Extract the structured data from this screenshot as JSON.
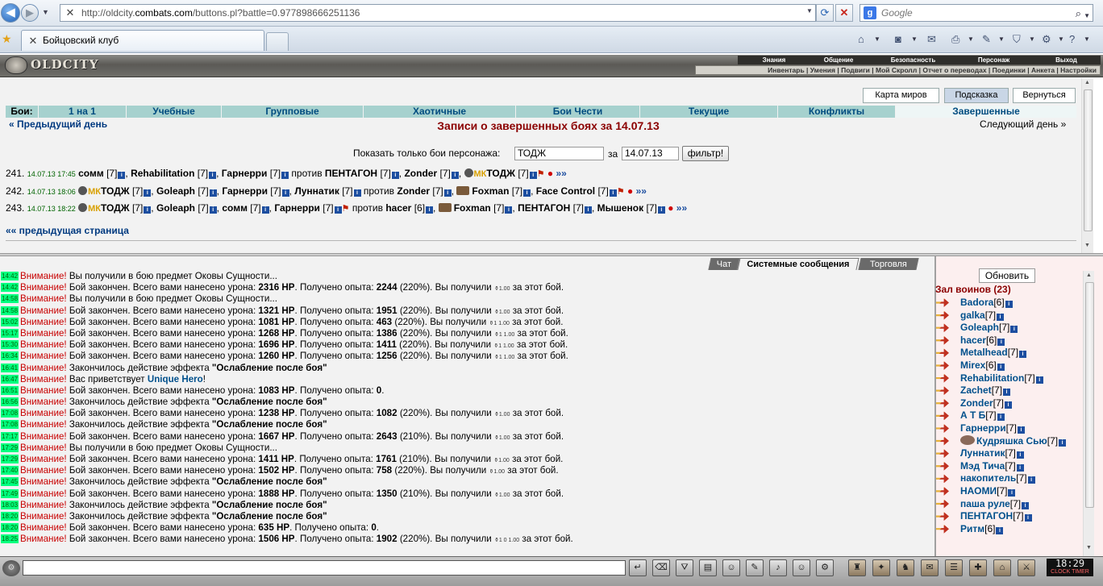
{
  "browser": {
    "url_prefix": "http://oldcity.",
    "url_domain": "combats.com",
    "url_path": "/buttons.pl?battle=0.977898666251136",
    "search_placeholder": "Google",
    "tab_title": "Бойцовский клуб"
  },
  "game": {
    "logo": "OLDCITY",
    "main_menu": [
      "Знания",
      "Общение",
      "Безопасность",
      "Персонаж",
      "Выход"
    ],
    "sub_menu": "Инвентарь | Умения | Подвиги | Мой Скролл | Отчет о переводах | Поединки | Анкета | Настройки"
  },
  "header_buttons": [
    "Карта миров",
    "Подсказка",
    "Вернуться"
  ],
  "fight_nav": [
    "Бои:",
    "1 на 1",
    "Учебные",
    "Групповые",
    "Хаотичные",
    "Бои Чести",
    "Текущие",
    "Конфликты",
    "Завершенные"
  ],
  "prev_day": "« Предыдущий день",
  "page_title": "Записи о завершенных боях за 14.07.13",
  "next_day": "Следующий день »",
  "filter": {
    "label": "Показать только бои персонажа:",
    "name": "ТОДЖ",
    "date_label": "за",
    "date": "14.07.13",
    "button": "фильтр!"
  },
  "battles": [
    {
      "num": "241.",
      "time": "14.07.13 17:45",
      "left": [
        {
          "n": "сомм",
          "l": "[7]"
        },
        {
          "n": "Rehabilitation",
          "l": "[7]"
        },
        {
          "n": "Гарнерри",
          "l": "[7]"
        }
      ],
      "vs": "против",
      "right": [
        {
          "n": "ПЕНТАГОН",
          "l": "[7]"
        },
        {
          "n": "Zonder",
          "l": "[7]"
        },
        {
          "n": "ТОДЖ",
          "l": "[7]",
          "clan": "МК"
        }
      ]
    },
    {
      "num": "242.",
      "time": "14.07.13 18:06",
      "left": [
        {
          "n": "ТОДЖ",
          "l": "[7]",
          "clan": "МК"
        },
        {
          "n": "Goleaph",
          "l": "[7]"
        },
        {
          "n": "Гарнерри",
          "l": "[7]"
        },
        {
          "n": "Луннатик",
          "l": "[7]"
        }
      ],
      "vs": "против",
      "right": [
        {
          "n": "Zonder",
          "l": "[7]"
        },
        {
          "n": "Foxman",
          "l": "[7]",
          "img": true
        },
        {
          "n": "Face Control",
          "l": "[7]"
        }
      ]
    },
    {
      "num": "243.",
      "time": "14.07.13 18:22",
      "left": [
        {
          "n": "ТОДЖ",
          "l": "[7]",
          "clan": "МК"
        },
        {
          "n": "Goleaph",
          "l": "[7]"
        },
        {
          "n": "сомм",
          "l": "[7]"
        },
        {
          "n": "Гарнерри",
          "l": "[7]"
        }
      ],
      "vs": "против",
      "right": [
        {
          "n": "hacer",
          "l": "[6]"
        },
        {
          "n": "Foxman",
          "l": "[7]",
          "img": true
        },
        {
          "n": "ПЕНТАГОН",
          "l": "[7]"
        },
        {
          "n": "Мышенок",
          "l": "[7]"
        }
      ]
    }
  ],
  "more": "»»",
  "prev_page": "«« предыдущая страница",
  "chat_tabs": [
    "Чат",
    "Системные сообщения",
    "Торговля"
  ],
  "messages": [
    {
      "t": "14:42",
      "type": "item",
      "text": "Вы получили в бою предмет Оковы Сущности..."
    },
    {
      "t": "14:42",
      "type": "fight",
      "dmg": "2316 HP",
      "exp": "2244",
      "pct": "(220%).",
      "coins": "1.00"
    },
    {
      "t": "14:58",
      "type": "item",
      "text": "Вы получили в бою предмет Оковы Сущности..."
    },
    {
      "t": "14:58",
      "type": "fight",
      "dmg": "1321 HP",
      "exp": "1951",
      "pct": "(220%).",
      "coins": "1.00"
    },
    {
      "t": "15:02",
      "type": "fight",
      "dmg": "1081 HP",
      "exp": "463",
      "pct": "(220%).",
      "coins": "1 1.00"
    },
    {
      "t": "15:17",
      "type": "fight",
      "dmg": "1268 HP",
      "exp": "1386",
      "pct": "(220%).",
      "coins": "1 1.00"
    },
    {
      "t": "15:30",
      "type": "fight",
      "dmg": "1696 HP",
      "exp": "1411",
      "pct": "(220%).",
      "coins": "1 1.00"
    },
    {
      "t": "16:34",
      "type": "fight",
      "dmg": "1260 HP",
      "exp": "1256",
      "pct": "(220%).",
      "coins": "1 1.00"
    },
    {
      "t": "16:41",
      "type": "effect"
    },
    {
      "t": "16:47",
      "type": "hero"
    },
    {
      "t": "16:51",
      "type": "fight0",
      "dmg": "1083 HP",
      "exp": "0"
    },
    {
      "t": "16:56",
      "type": "effect"
    },
    {
      "t": "17:08",
      "type": "fight",
      "dmg": "1238 HP",
      "exp": "1082",
      "pct": "(220%).",
      "coins": "1.00"
    },
    {
      "t": "17:08",
      "type": "effect"
    },
    {
      "t": "17:17",
      "type": "fight",
      "dmg": "1667 HP",
      "exp": "2643",
      "pct": "(210%).",
      "coins": "1.00"
    },
    {
      "t": "17:29",
      "type": "item",
      "text": "Вы получили в бою предмет Оковы Сущности..."
    },
    {
      "t": "17:29",
      "type": "fight",
      "dmg": "1411 HP",
      "exp": "1761",
      "pct": "(210%).",
      "coins": "1.00"
    },
    {
      "t": "17:40",
      "type": "fight",
      "dmg": "1502 HP",
      "exp": "758",
      "pct": "(220%).",
      "coins": "1.00"
    },
    {
      "t": "17:45",
      "type": "effect"
    },
    {
      "t": "17:49",
      "type": "fight",
      "dmg": "1888 HP",
      "exp": "1350",
      "pct": "(210%).",
      "coins": "1.00"
    },
    {
      "t": "18:03",
      "type": "effect"
    },
    {
      "t": "18:20",
      "type": "effect"
    },
    {
      "t": "18:20",
      "type": "fight0",
      "dmg": "635 HP",
      "exp": "0"
    },
    {
      "t": "18:25",
      "type": "fight",
      "dmg": "1506 HP",
      "exp": "1902",
      "pct": "(220%).",
      "coins": "1 0 1.00"
    }
  ],
  "msg_strings": {
    "warn": "Внимание!",
    "fight_a": "Бой закончен. Всего вами нанесено урона:",
    "fight_b": ". Получено опыта:",
    "fight_c": "Вы получили",
    "fight_d": "за этот бой.",
    "effect_a": "Закончилось действие эффекта",
    "effect_name": "\"Ослабление после боя\"",
    "hero_a": "Вас приветствует",
    "hero_name": "Unique Hero",
    "hero_b": "!"
  },
  "refresh_button": "Обновить",
  "hall": "Зал воинов (23)",
  "users": [
    {
      "n": "Badora",
      "l": "[6]"
    },
    {
      "n": "galka",
      "l": "[7]"
    },
    {
      "n": "Goleaph",
      "l": "[7]"
    },
    {
      "n": "hacer",
      "l": "[6]"
    },
    {
      "n": "Metalhead",
      "l": "[7]"
    },
    {
      "n": "Mirex",
      "l": "[6]"
    },
    {
      "n": "Rehabilitation",
      "l": "[7]"
    },
    {
      "n": "Zachet",
      "l": "[7]"
    },
    {
      "n": "Zonder",
      "l": "[7]"
    },
    {
      "n": "А Т Б",
      "l": "[7]"
    },
    {
      "n": "Гарнерри",
      "l": "[7]"
    },
    {
      "n": "Кудряшка Сью",
      "l": "[7]",
      "img": true
    },
    {
      "n": "Луннатик",
      "l": "[7]"
    },
    {
      "n": "Мэд Тича",
      "l": "[7]"
    },
    {
      "n": "накопитель",
      "l": "[7]"
    },
    {
      "n": "НАОМИ",
      "l": "[7]"
    },
    {
      "n": "паша руле",
      "l": "[7]"
    },
    {
      "n": "ПЕНТАГОН",
      "l": "[7]"
    },
    {
      "n": "Ритм",
      "l": "[6]"
    }
  ],
  "clock": {
    "time": "18:29",
    "label": "CLOCK TIMER"
  }
}
